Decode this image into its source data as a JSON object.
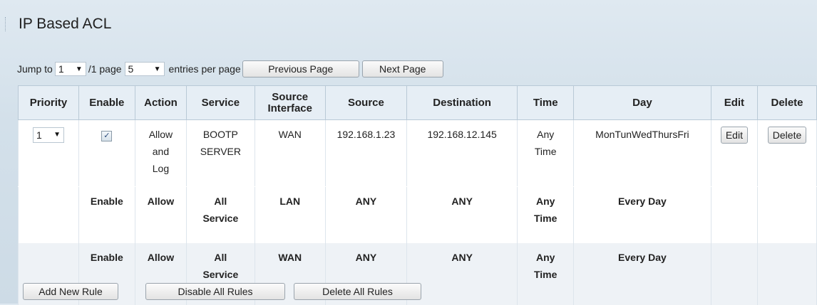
{
  "page": {
    "title": "IP Based ACL"
  },
  "pager": {
    "jump_to_label": "Jump to",
    "page_value": "1",
    "page_suffix": "/1 page",
    "entries_value": "5",
    "entries_suffix": "entries per page",
    "prev_label": "Previous Page",
    "next_label": "Next Page"
  },
  "table": {
    "headers": [
      "Priority",
      "Enable",
      "Action",
      "Service",
      "Source Interface",
      "Source",
      "Destination",
      "Time",
      "Day",
      "Edit",
      "Delete"
    ],
    "rows": [
      {
        "priority": "1",
        "enabled": true,
        "action": "Allow and Log",
        "service": "BOOTP SERVER",
        "source_interface": "WAN",
        "source": "192.168.1.23",
        "destination": "192.168.12.145",
        "time": "Any Time",
        "day": "MonTunWedThursFri",
        "edit_label": "Edit",
        "delete_label": "Delete"
      },
      {
        "enable": "Enable",
        "action": "Allow",
        "service": "All Service",
        "source_interface": "LAN",
        "source": "ANY",
        "destination": "ANY",
        "time": "Any Time",
        "day": "Every Day"
      },
      {
        "enable": "Enable",
        "action": "Allow",
        "service": "All Service",
        "source_interface": "WAN",
        "source": "ANY",
        "destination": "ANY",
        "time": "Any Time",
        "day": "Every Day"
      }
    ]
  },
  "actions": {
    "add_label": "Add New Rule",
    "disable_all_label": "Disable All Rules",
    "delete_all_label": "Delete All Rules"
  },
  "icons": {
    "dropdown": "chevron-down-icon",
    "checkbox_checked": "checkbox-checked-icon"
  }
}
